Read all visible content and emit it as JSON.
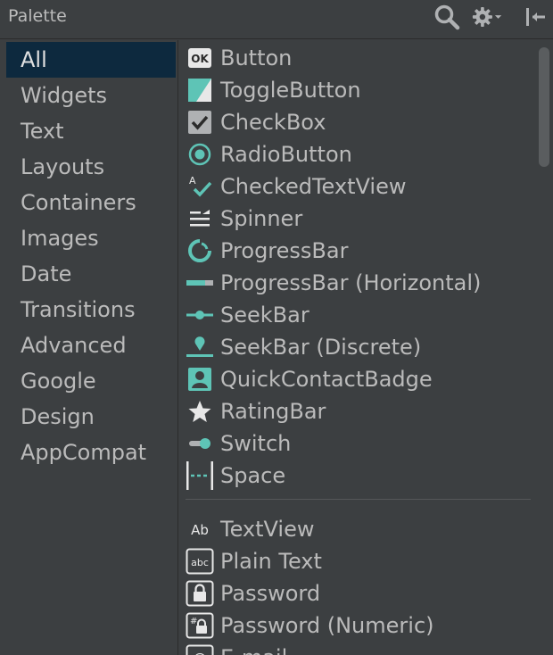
{
  "header": {
    "title": "Palette",
    "icons": [
      "search-icon",
      "gear-icon",
      "chevron-down-icon",
      "collapse-panel-icon"
    ]
  },
  "sidebar": {
    "selected": "All",
    "items": [
      {
        "label": "All"
      },
      {
        "label": "Widgets"
      },
      {
        "label": "Text"
      },
      {
        "label": "Layouts"
      },
      {
        "label": "Containers"
      },
      {
        "label": "Images"
      },
      {
        "label": "Date"
      },
      {
        "label": "Transitions"
      },
      {
        "label": "Advanced"
      },
      {
        "label": "Google"
      },
      {
        "label": "Design"
      },
      {
        "label": "AppCompat"
      }
    ]
  },
  "widgets": [
    {
      "label": "Button",
      "icon": "button-ok-icon"
    },
    {
      "label": "ToggleButton",
      "icon": "toggle-button-icon"
    },
    {
      "label": "CheckBox",
      "icon": "checkbox-icon"
    },
    {
      "label": "RadioButton",
      "icon": "radio-button-icon"
    },
    {
      "label": "CheckedTextView",
      "icon": "checked-text-view-icon"
    },
    {
      "label": "Spinner",
      "icon": "spinner-icon"
    },
    {
      "label": "ProgressBar",
      "icon": "progress-circle-icon"
    },
    {
      "label": "ProgressBar (Horizontal)",
      "icon": "progress-horizontal-icon"
    },
    {
      "label": "SeekBar",
      "icon": "seekbar-icon"
    },
    {
      "label": "SeekBar (Discrete)",
      "icon": "seekbar-discrete-icon"
    },
    {
      "label": "QuickContactBadge",
      "icon": "contact-badge-icon"
    },
    {
      "label": "RatingBar",
      "icon": "star-icon"
    },
    {
      "label": "Switch",
      "icon": "switch-icon"
    },
    {
      "label": "Space",
      "icon": "space-icon"
    }
  ],
  "text_widgets": [
    {
      "label": "TextView",
      "icon": "text-view-icon",
      "glyph": "Ab"
    },
    {
      "label": "Plain Text",
      "icon": "plain-text-icon",
      "glyph": "abc"
    },
    {
      "label": "Password",
      "icon": "password-lock-icon"
    },
    {
      "label": "Password (Numeric)",
      "icon": "password-numeric-icon",
      "glyph": "#"
    },
    {
      "label": "E-mail",
      "icon": "email-at-icon",
      "glyph": "@"
    }
  ],
  "colors": {
    "background": "#3c3f41",
    "selected_bg": "#0d293e",
    "text": "#bbbbbb",
    "icon_accent": "#5ec4b6",
    "icon_light": "#e8e8e8"
  }
}
